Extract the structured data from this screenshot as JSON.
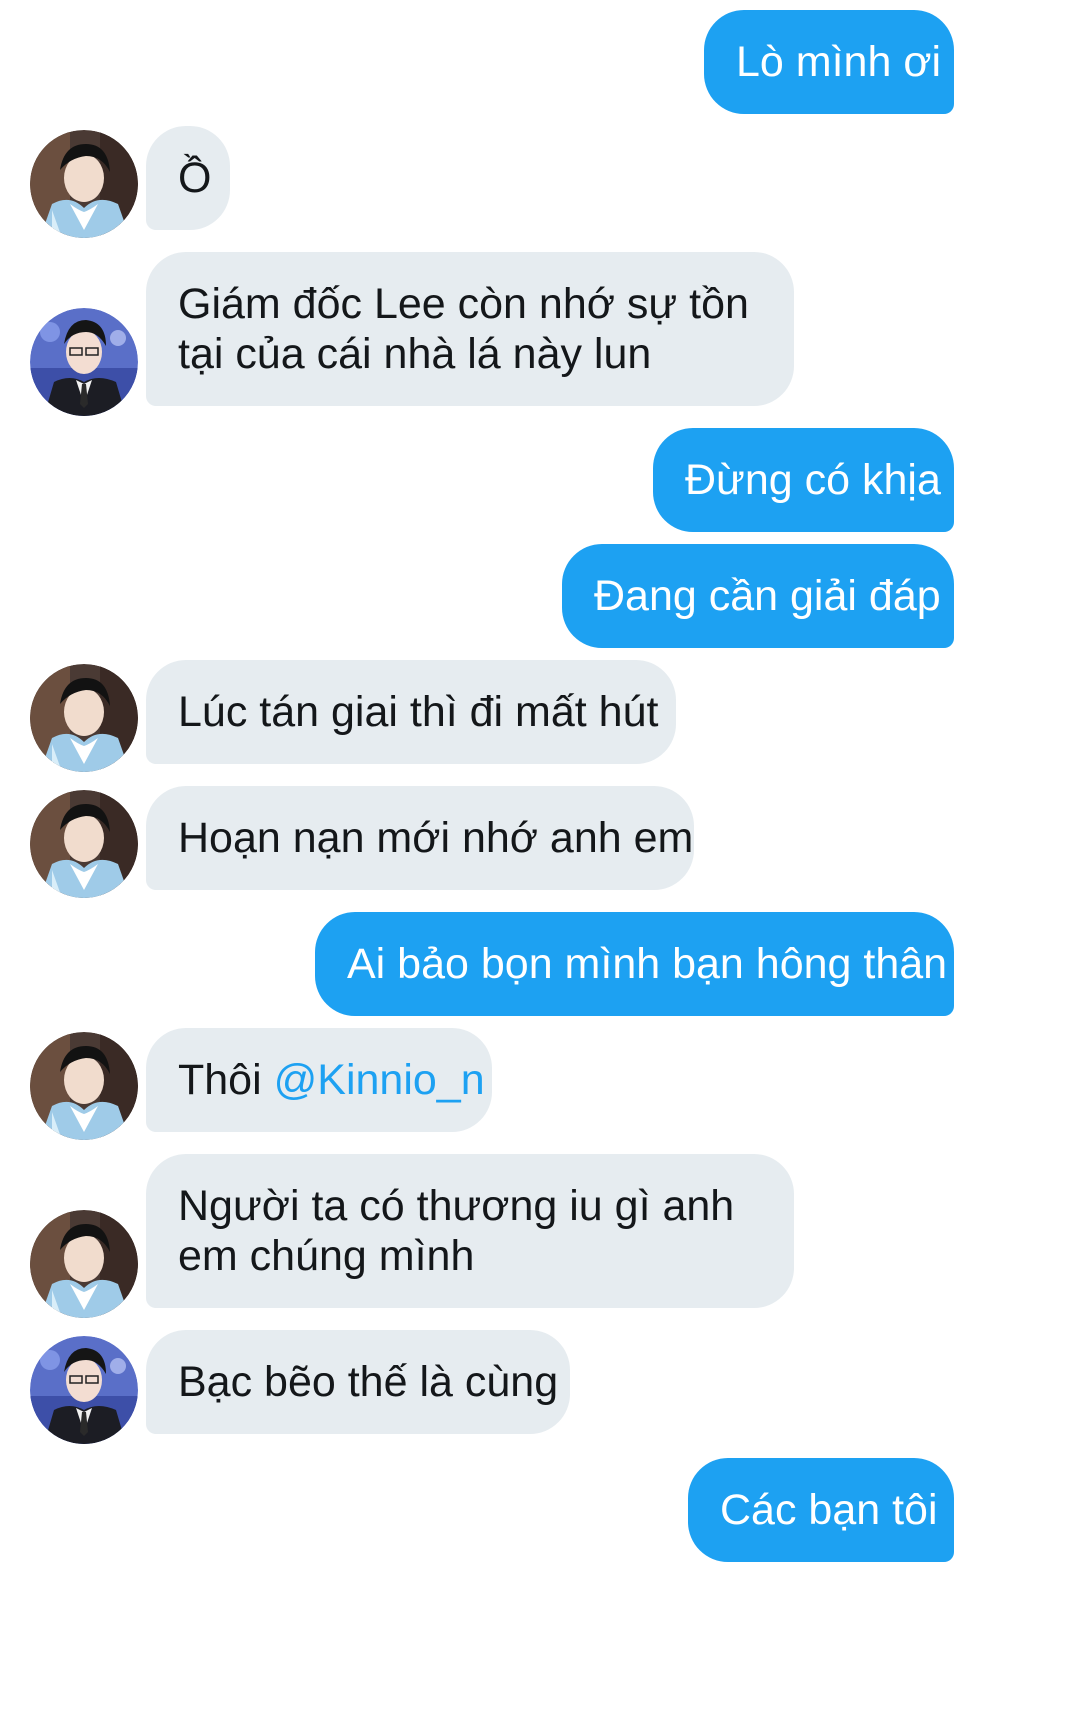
{
  "conversation": {
    "messages": [
      {
        "from": "me",
        "text": "Lò mình ơi"
      },
      {
        "from": "them",
        "avatar": "hanbok",
        "text": "Ồ"
      },
      {
        "from": "them",
        "avatar": "suit",
        "text": "Giám đốc Lee còn nhớ sự tồn tại của cái nhà lá này lun"
      },
      {
        "from": "me",
        "text": "Đừng có khịa"
      },
      {
        "from": "me",
        "text": "Đang cần giải đáp"
      },
      {
        "from": "them",
        "avatar": "hanbok",
        "text": "Lúc tán giai thì đi mất hút"
      },
      {
        "from": "them",
        "avatar": "hanbok",
        "text": "Hoạn nạn mới nhớ anh em"
      },
      {
        "from": "me",
        "text": "Ai bảo bọn mình bạn hông thân"
      },
      {
        "from": "them",
        "avatar": "hanbok",
        "text_prefix": "Thôi ",
        "mention": "@Kinnio_n"
      },
      {
        "from": "them",
        "avatar": "hanbok",
        "text": "Người ta có thương iu gì anh em chúng mình"
      },
      {
        "from": "them",
        "avatar": "suit",
        "text": "Bạc bẽo thế là cùng"
      },
      {
        "from": "me",
        "text": "Các bạn tôi"
      }
    ]
  },
  "colors": {
    "outgoing_bubble": "#1da1f2",
    "incoming_bubble": "#e6ecf0",
    "mention": "#1da1f2"
  },
  "icons": {
    "hanbok": "avatar-hanbok-photo",
    "suit": "avatar-suit-photo"
  }
}
